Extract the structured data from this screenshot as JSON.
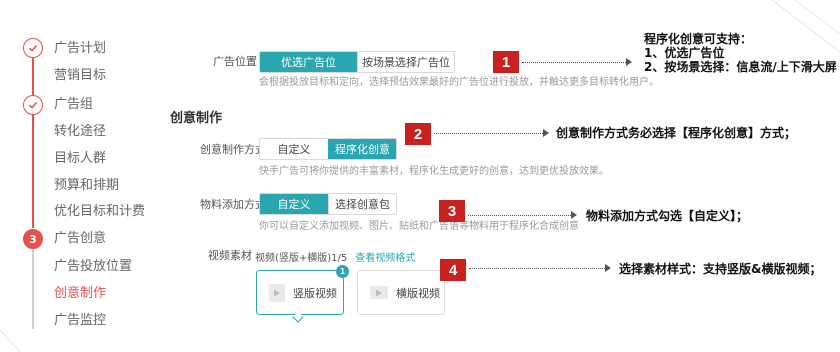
{
  "sidebar": {
    "items": [
      {
        "label": "广告计划",
        "kind": "group",
        "state": "done"
      },
      {
        "label": "营销目标",
        "kind": "sub"
      },
      {
        "label": "广告组",
        "kind": "group",
        "state": "done"
      },
      {
        "label": "转化途径",
        "kind": "sub"
      },
      {
        "label": "目标人群",
        "kind": "sub"
      },
      {
        "label": "预算和排期",
        "kind": "sub"
      },
      {
        "label": "优化目标和计费",
        "kind": "sub"
      },
      {
        "label": "广告创意",
        "kind": "group",
        "state": "current",
        "step": "3"
      },
      {
        "label": "广告投放位置",
        "kind": "sub"
      },
      {
        "label": "创意制作",
        "kind": "sub",
        "active": true
      },
      {
        "label": "广告监控",
        "kind": "sub"
      }
    ]
  },
  "placement": {
    "label": "广告位置",
    "options": [
      "优选广告位",
      "按场景选择广告位"
    ],
    "selected": "优选广告位",
    "hint": "会根据投放目标和定向，选择预估效果最好的广告位进行投放，并触达更多目标转化用户。"
  },
  "section_title": "创意制作",
  "creative_method": {
    "label": "创意制作方式",
    "options": [
      "自定义",
      "程序化创意"
    ],
    "selected": "程序化创意",
    "hint": "快手广告可将你提供的丰富素材，程序化生成更好的创意，达到更优投放效果。"
  },
  "material_method": {
    "label": "物料添加方式",
    "options": [
      "自定义",
      "选择创意包"
    ],
    "selected": "自定义",
    "hint": "你可以自定义添加视频、图片、贴纸和广告语等物料用于程序化合成创意"
  },
  "video": {
    "label": "视频素材",
    "meta": "视频(竖版+横版)1/5",
    "link": "查看视频格式",
    "cards": [
      {
        "label": "竖版视频",
        "selected": true,
        "badge": "1"
      },
      {
        "label": "横版视频",
        "selected": false
      }
    ]
  },
  "annotations": [
    {
      "num": "1"
    },
    {
      "num": "2",
      "text": "创意制作方式务必选择【程序化创意】方式；"
    },
    {
      "num": "3",
      "text": "物料添加方式勾选【自定义】；"
    },
    {
      "num": "4",
      "text": "选择素材样式：支持竖版&横版视频；"
    }
  ],
  "note1": {
    "line1": "程序化创意可支持：",
    "line2": "1、优选广告位",
    "line3": "2、按场景选择：信息流/上下滑大屏"
  },
  "colors": {
    "accent": "#2aa6b0",
    "step_red": "#e8504a",
    "annotation_red": "#c9211e"
  }
}
